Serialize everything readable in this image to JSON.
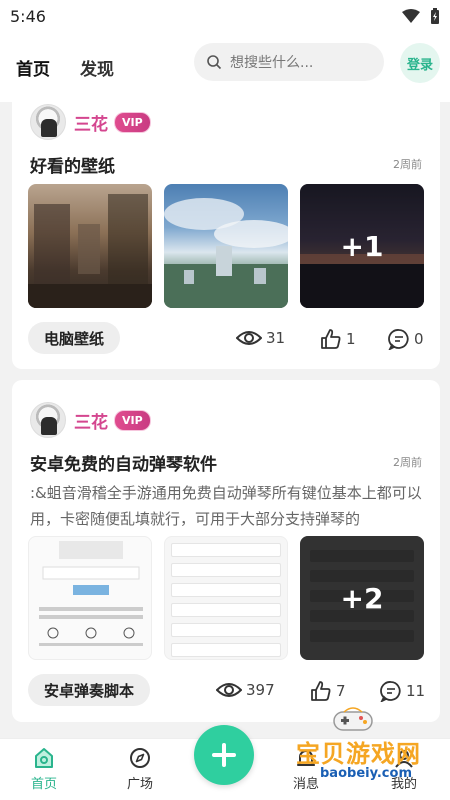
{
  "status_bar": {
    "time": "5:46"
  },
  "header": {
    "tabs": [
      {
        "label": "首页",
        "active": true
      },
      {
        "label": "发现",
        "active": false
      }
    ],
    "search_placeholder": "想搜些什么...",
    "login_label": "登录"
  },
  "posts": [
    {
      "author": "三花",
      "badge": "VIP",
      "title": "好看的壁纸",
      "time": "2周前",
      "extra_images": "+1",
      "tag": "电脑壁纸",
      "views": "31",
      "likes": "1",
      "comments": "0"
    },
    {
      "author": "三花",
      "badge": "VIP",
      "title": "安卓免费的自动弹琴软件",
      "time": "2周前",
      "description": ":&蛆音滑稽全手游通用免费自动弹琴所有键位基本上都可以用，卡密随便乱填就行，可用于大部分支持弹琴的",
      "extra_images": "+2",
      "tag": "安卓弹奏脚本",
      "views": "397",
      "likes": "7",
      "comments": "11"
    }
  ],
  "bottom_nav": {
    "items": [
      {
        "label": "首页",
        "active": true
      },
      {
        "label": "广场",
        "active": false
      },
      {
        "label": "消息",
        "active": false
      },
      {
        "label": "我的",
        "active": false
      }
    ]
  },
  "watermark": {
    "title": "宝贝游戏网",
    "url": "baobeiy.com"
  },
  "colors": {
    "accent": "#2fcf9f",
    "vip": "#d4468f"
  }
}
